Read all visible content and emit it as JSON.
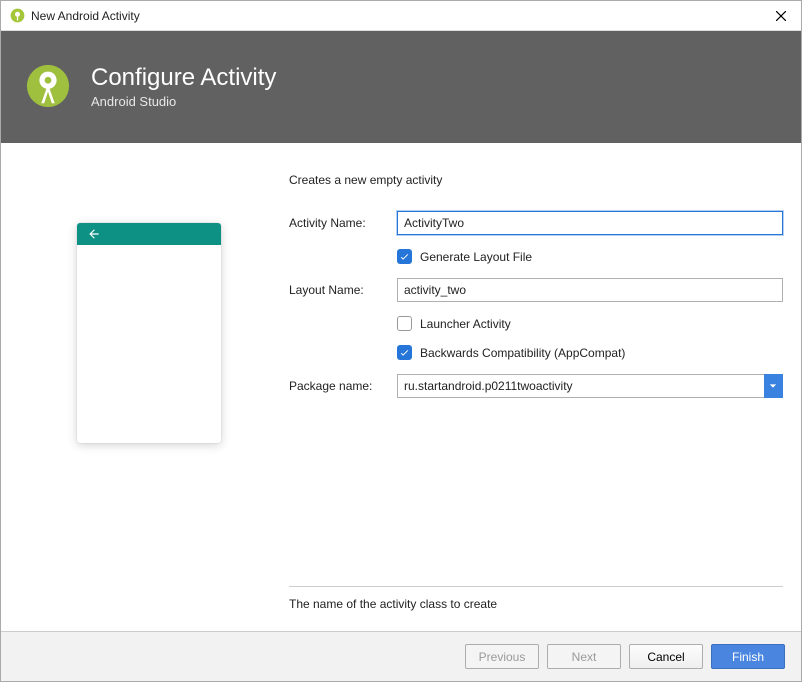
{
  "window": {
    "title": "New Android Activity"
  },
  "header": {
    "title": "Configure Activity",
    "subtitle": "Android Studio"
  },
  "form": {
    "description": "Creates a new empty activity",
    "activity_name_label": "Activity Name:",
    "activity_name_value": "ActivityTwo",
    "generate_layout_label": "Generate Layout File",
    "generate_layout_checked": true,
    "layout_name_label": "Layout Name:",
    "layout_name_value": "activity_two",
    "launcher_label": "Launcher Activity",
    "launcher_checked": false,
    "backcompat_label": "Backwards Compatibility (AppCompat)",
    "backcompat_checked": true,
    "package_label": "Package name:",
    "package_value": "ru.startandroid.p0211twoactivity",
    "hint": "The name of the activity class to create"
  },
  "footer": {
    "previous": "Previous",
    "next": "Next",
    "cancel": "Cancel",
    "finish": "Finish"
  },
  "colors": {
    "accent": "#2576d8",
    "teal": "#0d9185"
  }
}
